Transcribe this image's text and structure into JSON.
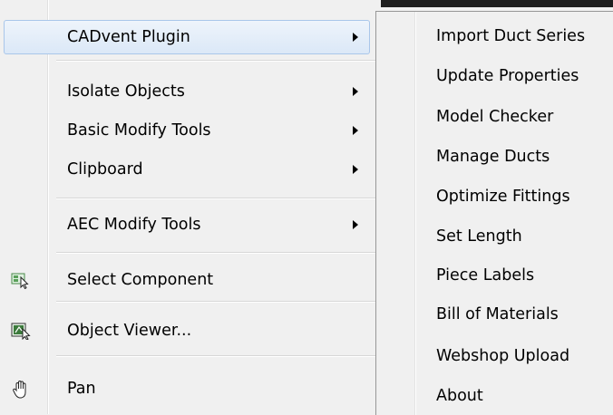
{
  "context_menu": {
    "items": [
      {
        "label": "CADvent Plugin",
        "submenu": true,
        "highlighted": true
      },
      {
        "label": "Isolate Objects",
        "submenu": true
      },
      {
        "label": "Basic Modify Tools",
        "submenu": true
      },
      {
        "label": "Clipboard",
        "submenu": true
      },
      {
        "label": "AEC Modify Tools",
        "submenu": true
      },
      {
        "label": "Select Component",
        "icon": "select-component-icon"
      },
      {
        "label": "Object Viewer...",
        "icon": "object-viewer-icon"
      },
      {
        "label": "Pan",
        "icon": "pan-hand-icon"
      }
    ]
  },
  "submenu": {
    "items": [
      {
        "label": "Import Duct Series"
      },
      {
        "label": "Update Properties"
      },
      {
        "label": "Model Checker"
      },
      {
        "label": "Manage Ducts"
      },
      {
        "label": "Optimize Fittings"
      },
      {
        "label": "Set Length"
      },
      {
        "label": "Piece Labels"
      },
      {
        "label": "Bill of Materials"
      },
      {
        "label": "Webshop Upload"
      },
      {
        "label": "About"
      }
    ]
  },
  "colors": {
    "highlight": "#dbe8f7",
    "highlight_border": "#a9c6ea",
    "menu_bg": "#f0f0f0"
  }
}
